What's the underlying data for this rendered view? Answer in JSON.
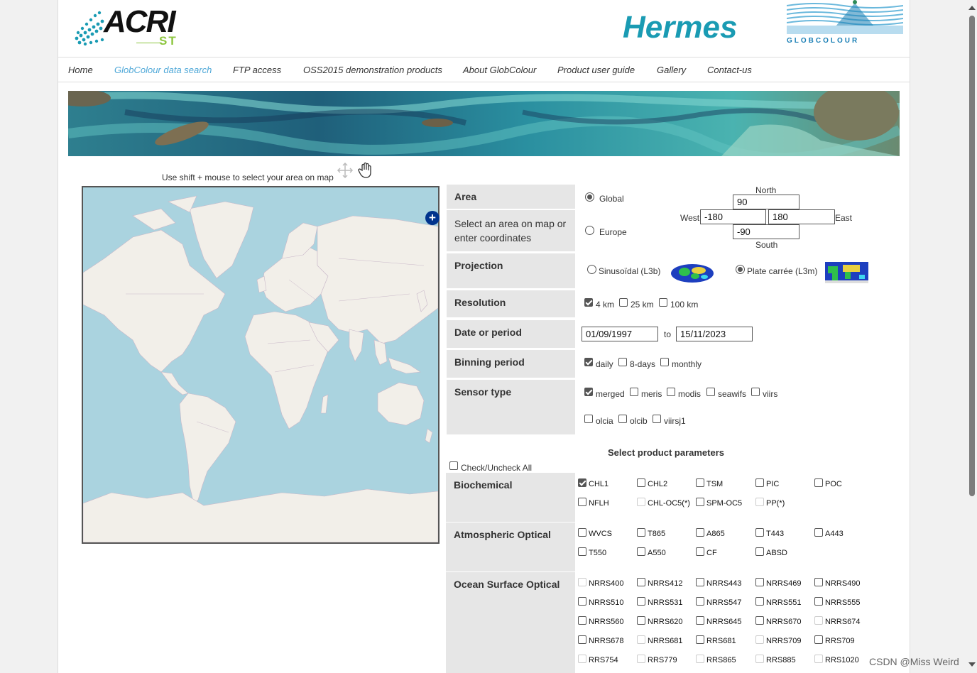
{
  "header": {
    "acri_logo": "ACRI",
    "acri_sub": "ST",
    "hermes_logo": "Hermes",
    "globcolour_logo": "GLOBCOLOUR"
  },
  "nav": {
    "items": [
      "Home",
      "GlobColour data search",
      "FTP access",
      "OSS2015 demonstration products",
      "About GlobColour",
      "Product user guide",
      "Gallery",
      "Contact-us"
    ],
    "active_index": 1
  },
  "map": {
    "hint": "Use shift + mouse to select your area on map",
    "zoom_in": "+"
  },
  "area": {
    "label": "Area",
    "sub_label": "Select an area on map or enter coordinates",
    "options": [
      {
        "label": "Global",
        "selected": true
      },
      {
        "label": "Europe",
        "selected": false
      }
    ],
    "north_label": "North",
    "south_label": "South",
    "west_label": "West",
    "east_label": "East",
    "north": "90",
    "west": "-180",
    "east": "180",
    "south": "-90"
  },
  "projection": {
    "label": "Projection",
    "options": [
      {
        "label": "Sinusoïdal (L3b)",
        "selected": false
      },
      {
        "label": "Plate carrée (L3m)",
        "selected": true
      }
    ]
  },
  "resolution": {
    "label": "Resolution",
    "options": [
      {
        "label": "4 km",
        "checked": true
      },
      {
        "label": "25 km",
        "checked": false
      },
      {
        "label": "100 km",
        "checked": false
      }
    ]
  },
  "date": {
    "label": "Date or period",
    "from": "01/09/1997",
    "to_label": "to",
    "to": "15/11/2023"
  },
  "binning": {
    "label": "Binning period",
    "options": [
      {
        "label": "daily",
        "checked": true
      },
      {
        "label": "8-days",
        "checked": false
      },
      {
        "label": "monthly",
        "checked": false
      }
    ]
  },
  "sensor": {
    "label": "Sensor type",
    "row1": [
      {
        "label": "merged",
        "checked": true
      },
      {
        "label": "meris",
        "checked": false
      },
      {
        "label": "modis",
        "checked": false
      },
      {
        "label": "seawifs",
        "checked": false
      },
      {
        "label": "viirs",
        "checked": false
      }
    ],
    "row2": [
      {
        "label": "olcia",
        "checked": false
      },
      {
        "label": "olcib",
        "checked": false
      },
      {
        "label": "viirsj1",
        "checked": false
      }
    ]
  },
  "params": {
    "title": "Select product parameters",
    "check_all": "Check/Uncheck All",
    "groups": [
      {
        "label": "Biochemical",
        "rows": [
          [
            {
              "label": "CHL1",
              "checked": true
            },
            {
              "label": "CHL2"
            },
            {
              "label": "TSM"
            },
            {
              "label": "PIC"
            },
            {
              "label": "POC"
            }
          ],
          [
            {
              "label": "NFLH"
            },
            {
              "label": "CHL-OC5(*)",
              "disabled": true
            },
            {
              "label": "SPM-OC5"
            },
            {
              "label": "PP(*)",
              "disabled": true
            }
          ]
        ]
      },
      {
        "label": "Atmospheric Optical",
        "rows": [
          [
            {
              "label": "WVCS"
            },
            {
              "label": "T865"
            },
            {
              "label": "A865"
            },
            {
              "label": "T443"
            },
            {
              "label": "A443"
            }
          ],
          [
            {
              "label": "T550"
            },
            {
              "label": "A550"
            },
            {
              "label": "CF"
            },
            {
              "label": "ABSD"
            }
          ]
        ]
      },
      {
        "label": "Ocean Surface Optical",
        "rows": [
          [
            {
              "label": "NRRS400",
              "disabled": true
            },
            {
              "label": "NRRS412"
            },
            {
              "label": "NRRS443"
            },
            {
              "label": "NRRS469"
            },
            {
              "label": "NRRS490"
            }
          ],
          [
            {
              "label": "NRRS510"
            },
            {
              "label": "NRRS531"
            },
            {
              "label": "NRRS547"
            },
            {
              "label": "NRRS551"
            },
            {
              "label": "NRRS555"
            }
          ],
          [
            {
              "label": "NRRS560"
            },
            {
              "label": "NRRS620"
            },
            {
              "label": "NRRS645"
            },
            {
              "label": "NRRS670"
            },
            {
              "label": "NRRS674",
              "disabled": true
            }
          ],
          [
            {
              "label": "NRRS678"
            },
            {
              "label": "NRRS681",
              "disabled": true
            },
            {
              "label": "RRS681"
            },
            {
              "label": "NRRS709",
              "disabled": true
            },
            {
              "label": "RRS709"
            }
          ],
          [
            {
              "label": "RRS754",
              "disabled": true
            },
            {
              "label": "RRS779",
              "disabled": true
            },
            {
              "label": "RRS865",
              "disabled": true
            },
            {
              "label": "RRS885",
              "disabled": true
            },
            {
              "label": "RRS1020",
              "disabled": true
            }
          ]
        ]
      }
    ]
  },
  "watermark": "CSDN @Miss Weird",
  "colors": {
    "accent": "#4fa8d8",
    "label_bg": "#e6e6e6",
    "ocean": "#aad3df",
    "land": "#f2efe9"
  }
}
